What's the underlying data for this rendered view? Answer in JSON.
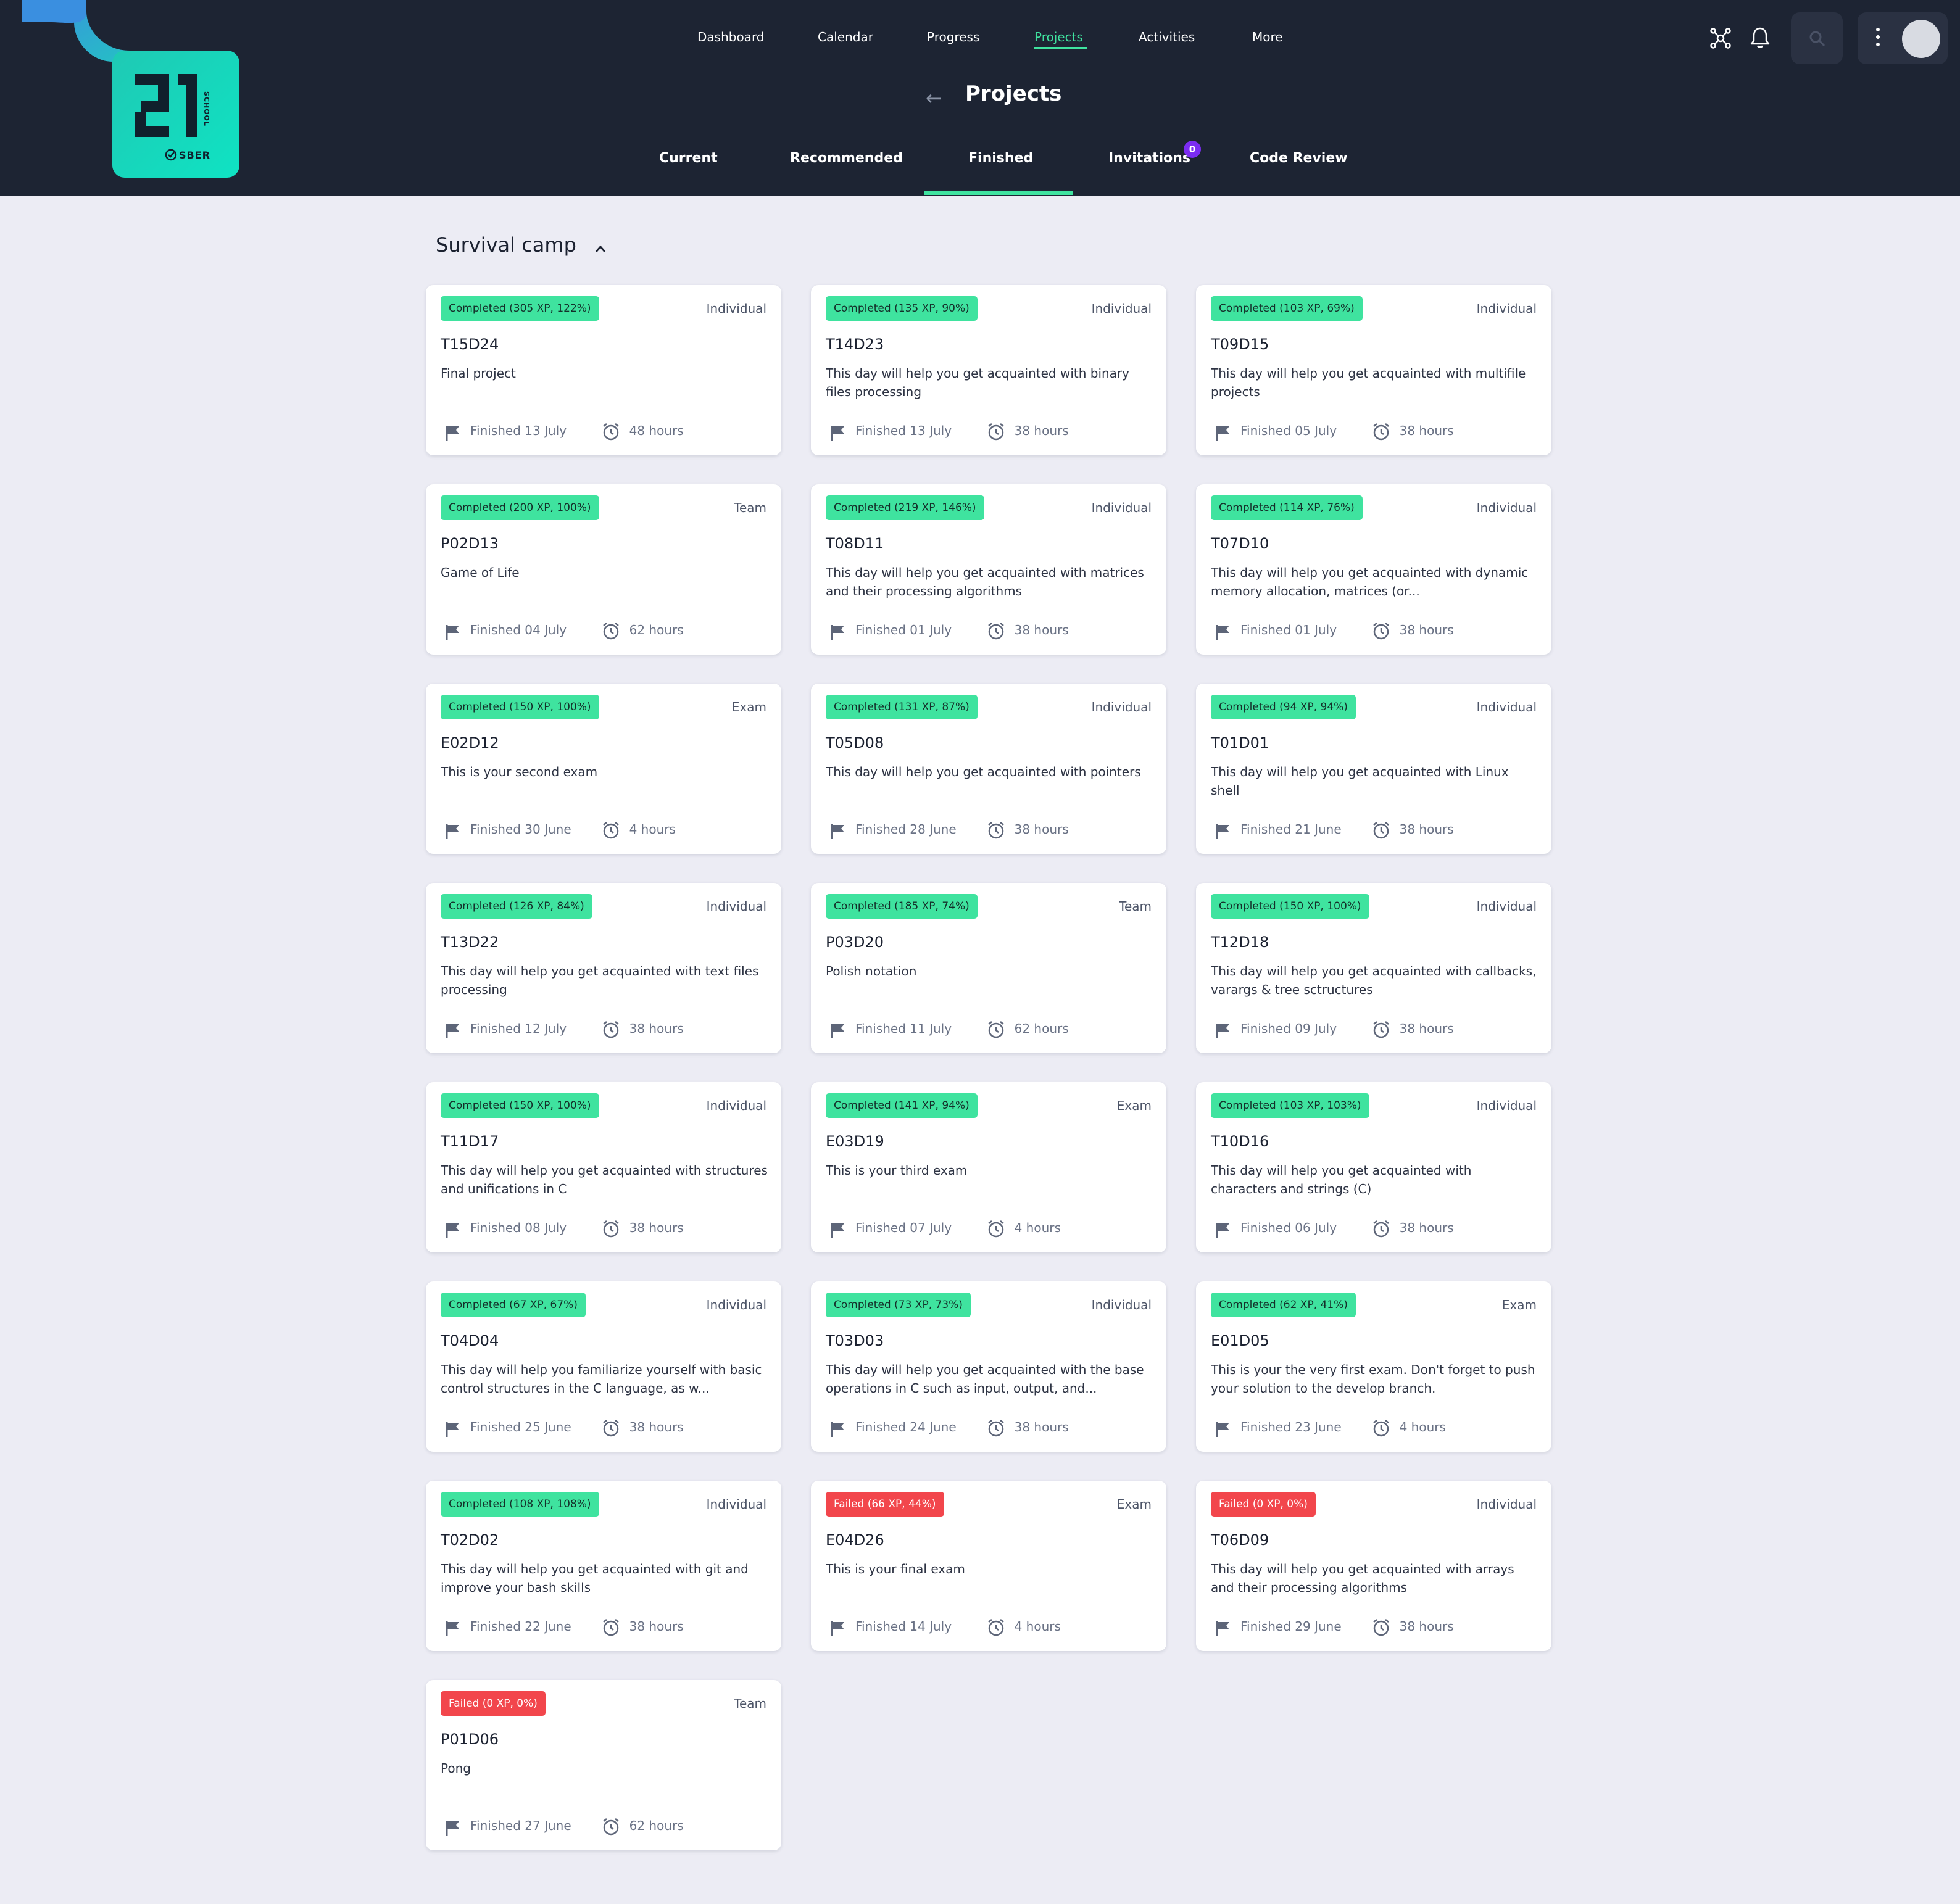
{
  "brand": {
    "logo_number": "21",
    "logo_sub": "SBER",
    "logo_side": "SCHOOL"
  },
  "topnav": [
    "Dashboard",
    "Calendar",
    "Progress",
    "Projects",
    "Activities",
    "More"
  ],
  "page_title": "Projects",
  "subtabs": [
    "Current",
    "Recommended",
    "Finished",
    "Invitations",
    "Code Review"
  ],
  "active_subtab": "Finished",
  "invitations_count": "0",
  "section_title": "Survival camp",
  "colors": {
    "header": "#1d2433",
    "accent": "#3fe39f",
    "failed": "#f2464c",
    "badge": "#7b2cf2"
  },
  "projects": [
    {
      "status": "Completed (305 XP, 122%)",
      "type": "Individual",
      "code": "T15D24",
      "desc": "Final project",
      "finished": "Finished 13 July",
      "hours": "48 hours",
      "ok": true
    },
    {
      "status": "Completed (135 XP, 90%)",
      "type": "Individual",
      "code": "T14D23",
      "desc": "This day will help you get acquainted with binary files processing",
      "finished": "Finished 13 July",
      "hours": "38 hours",
      "ok": true
    },
    {
      "status": "Completed (103 XP, 69%)",
      "type": "Individual",
      "code": "T09D15",
      "desc": "This day will help you get acquainted with multifile projects",
      "finished": "Finished 05 July",
      "hours": "38 hours",
      "ok": true
    },
    {
      "status": "Completed (200 XP, 100%)",
      "type": "Team",
      "code": "P02D13",
      "desc": "Game of Life",
      "finished": "Finished 04 July",
      "hours": "62 hours",
      "ok": true
    },
    {
      "status": "Completed (219 XP, 146%)",
      "type": "Individual",
      "code": "T08D11",
      "desc": "This day will help you get acquainted with matrices and their processing algorithms",
      "finished": "Finished 01 July",
      "hours": "38 hours",
      "ok": true
    },
    {
      "status": "Completed (114 XP, 76%)",
      "type": "Individual",
      "code": "T07D10",
      "desc": "This day will help you get acquainted with dynamic memory allocation, matrices (or...",
      "finished": "Finished 01 July",
      "hours": "38 hours",
      "ok": true
    },
    {
      "status": "Completed (150 XP, 100%)",
      "type": "Exam",
      "code": "E02D12",
      "desc": "This is your second exam",
      "finished": "Finished 30 June",
      "hours": "4 hours",
      "ok": true
    },
    {
      "status": "Completed (131 XP, 87%)",
      "type": "Individual",
      "code": "T05D08",
      "desc": "This day will help you get acquainted with pointers",
      "finished": "Finished 28 June",
      "hours": "38 hours",
      "ok": true
    },
    {
      "status": "Completed (94 XP, 94%)",
      "type": "Individual",
      "code": "T01D01",
      "desc": "This day will help you get acquainted with Linux shell",
      "finished": "Finished 21 June",
      "hours": "38 hours",
      "ok": true
    },
    {
      "status": "Completed (126 XP, 84%)",
      "type": "Individual",
      "code": "T13D22",
      "desc": "This day will help you get acquainted with text files processing",
      "finished": "Finished 12 July",
      "hours": "38 hours",
      "ok": true
    },
    {
      "status": "Completed (185 XP, 74%)",
      "type": "Team",
      "code": "P03D20",
      "desc": "Polish notation",
      "finished": "Finished 11 July",
      "hours": "62 hours",
      "ok": true
    },
    {
      "status": "Completed (150 XP, 100%)",
      "type": "Individual",
      "code": "T12D18",
      "desc": "This day will help you get acquainted with callbacks, varargs & tree sctructures",
      "finished": "Finished 09 July",
      "hours": "38 hours",
      "ok": true
    },
    {
      "status": "Completed (150 XP, 100%)",
      "type": "Individual",
      "code": "T11D17",
      "desc": "This day will help you get acquainted with structures and unifications in C",
      "finished": "Finished 08 July",
      "hours": "38 hours",
      "ok": true
    },
    {
      "status": "Completed (141 XP, 94%)",
      "type": "Exam",
      "code": "E03D19",
      "desc": "This is your third exam",
      "finished": "Finished 07 July",
      "hours": "4 hours",
      "ok": true
    },
    {
      "status": "Completed (103 XP, 103%)",
      "type": "Individual",
      "code": "T10D16",
      "desc": "This day will help you get acquainted with characters and strings (C)",
      "finished": "Finished 06 July",
      "hours": "38 hours",
      "ok": true
    },
    {
      "status": "Completed (67 XP, 67%)",
      "type": "Individual",
      "code": "T04D04",
      "desc": "This day will help you familiarize yourself with basic control structures in the C language, as w...",
      "finished": "Finished 25 June",
      "hours": "38 hours",
      "ok": true
    },
    {
      "status": "Completed (73 XP, 73%)",
      "type": "Individual",
      "code": "T03D03",
      "desc": "This day will help you get acquainted with the base operations in C such as input, output, and...",
      "finished": "Finished 24 June",
      "hours": "38 hours",
      "ok": true
    },
    {
      "status": "Completed (62 XP, 41%)",
      "type": "Exam",
      "code": "E01D05",
      "desc": "This is your the very first exam. Don't forget to push your solution to the develop branch.",
      "finished": "Finished 23 June",
      "hours": "4 hours",
      "ok": true
    },
    {
      "status": "Completed (108 XP, 108%)",
      "type": "Individual",
      "code": "T02D02",
      "desc": "This day will help you get acquainted with git and improve your bash skills",
      "finished": "Finished 22 June",
      "hours": "38 hours",
      "ok": true
    },
    {
      "status": "Failed (66 XP, 44%)",
      "type": "Exam",
      "code": "E04D26",
      "desc": "This is your final exam",
      "finished": "Finished 14 July",
      "hours": "4 hours",
      "ok": false
    },
    {
      "status": "Failed (0 XP, 0%)",
      "type": "Individual",
      "code": "T06D09",
      "desc": "This day will help you get acquainted with arrays and their processing algorithms",
      "finished": "Finished 29 June",
      "hours": "38 hours",
      "ok": false
    },
    {
      "status": "Failed (0 XP, 0%)",
      "type": "Team",
      "code": "P01D06",
      "desc": "Pong",
      "finished": "Finished 27 June",
      "hours": "62 hours",
      "ok": false
    }
  ]
}
